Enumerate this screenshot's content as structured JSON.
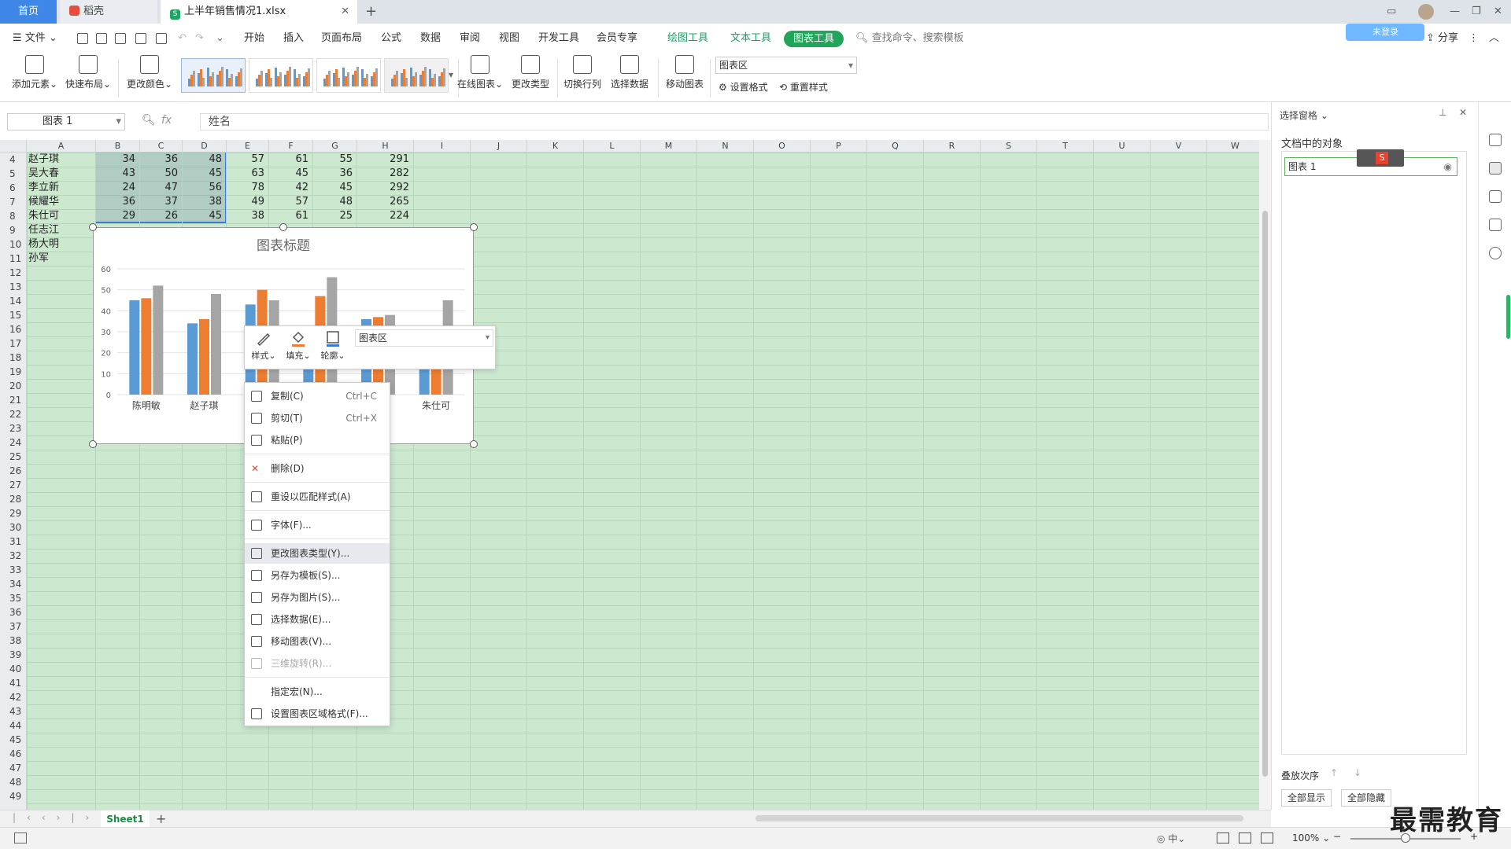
{
  "tabs": {
    "home": "首页",
    "daoke": "稻壳",
    "file": "上半年销售情况1.xlsx"
  },
  "menu": {
    "file": "文件",
    "items": [
      "开始",
      "插入",
      "页面布局",
      "公式",
      "数据",
      "审阅",
      "视图",
      "开发工具",
      "会员专享"
    ],
    "tools": [
      "绘图工具",
      "文本工具"
    ],
    "active_tool": "图表工具",
    "search": "查找命令、搜索模板",
    "share": "分享",
    "login_badge": "未登录"
  },
  "ribbon": {
    "add_element": "添加元素",
    "quick_layout": "快速布局",
    "change_color": "更改颜色",
    "online_chart": "在线图表",
    "change_type": "更改类型",
    "switch_row_col": "切换行列",
    "select_data": "选择数据",
    "move_chart": "移动图表",
    "area_select": "图表区",
    "set_format": "设置格式",
    "reset_style": "重置样式"
  },
  "formula": {
    "namebox": "图表 1",
    "fx": "fx",
    "value": "姓名"
  },
  "grid": {
    "columns": [
      "A",
      "B",
      "C",
      "D",
      "E",
      "F",
      "G",
      "H",
      "I",
      "J",
      "K",
      "L",
      "M",
      "N",
      "O",
      "P",
      "Q",
      "R",
      "S",
      "T",
      "U",
      "V",
      "W"
    ],
    "rows": [
      {
        "n": "4",
        "name": "赵子琪",
        "vals": [
          "34",
          "36",
          "48",
          "57",
          "61",
          "55",
          "291"
        ]
      },
      {
        "n": "5",
        "name": "吴大春",
        "vals": [
          "43",
          "50",
          "45",
          "63",
          "45",
          "36",
          "282"
        ]
      },
      {
        "n": "6",
        "name": "李立新",
        "vals": [
          "24",
          "47",
          "56",
          "78",
          "42",
          "45",
          "292"
        ]
      },
      {
        "n": "7",
        "name": "候耀华",
        "vals": [
          "36",
          "37",
          "38",
          "49",
          "57",
          "48",
          "265"
        ]
      },
      {
        "n": "8",
        "name": "朱仕可",
        "vals": [
          "29",
          "26",
          "45",
          "38",
          "61",
          "25",
          "224"
        ]
      },
      {
        "n": "9",
        "name": "任志江",
        "vals": []
      },
      {
        "n": "10",
        "name": "杨大明",
        "vals": []
      },
      {
        "n": "11",
        "name": "孙军",
        "vals": []
      }
    ],
    "row_numbers": [
      "12",
      "13",
      "14",
      "15",
      "16",
      "17",
      "18",
      "19",
      "20",
      "21",
      "22",
      "23",
      "24",
      "25",
      "26",
      "27",
      "28",
      "29",
      "30",
      "31",
      "32",
      "33",
      "34",
      "35",
      "36",
      "37",
      "38",
      "39",
      "40",
      "41",
      "42",
      "43",
      "44",
      "45",
      "46",
      "47",
      "48",
      "49"
    ]
  },
  "chart_data": {
    "type": "bar",
    "title": "图表标题",
    "categories": [
      "陈明敏",
      "赵子琪",
      "吴大春",
      "李立新",
      "候耀华",
      "朱仕可"
    ],
    "visible_category_labels": [
      "陈明敏",
      "赵子琪",
      "",
      "",
      "",
      "朱仕可"
    ],
    "series": [
      {
        "values": [
          45,
          34,
          43,
          24,
          36,
          29
        ],
        "color": "#5b9bd5"
      },
      {
        "values": [
          46,
          36,
          50,
          47,
          37,
          26
        ],
        "color": "#ed7d31"
      },
      {
        "values": [
          52,
          48,
          45,
          56,
          38,
          45
        ],
        "color": "#a5a5a5"
      }
    ],
    "ylim": [
      0,
      60
    ],
    "yticks": [
      "0",
      "10",
      "20",
      "30",
      "40",
      "50",
      "60"
    ],
    "grid": true
  },
  "minitb": {
    "style": "样式",
    "fill": "填充",
    "outline": "轮廓",
    "select": "图表区"
  },
  "context_menu": [
    {
      "label": "复制(C)",
      "shortcut": "Ctrl+C",
      "icon": "copy-icon"
    },
    {
      "label": "剪切(T)",
      "shortcut": "Ctrl+X",
      "icon": "cut-icon"
    },
    {
      "label": "粘贴(P)",
      "shortcut": "",
      "icon": "paste-icon"
    },
    {
      "label": "删除(D)",
      "shortcut": "",
      "icon": "delete-icon"
    },
    {
      "label": "重设以匹配样式(A)",
      "shortcut": "",
      "icon": "reset-style-icon"
    },
    {
      "label": "字体(F)...",
      "shortcut": "",
      "icon": "font-icon"
    },
    {
      "label": "更改图表类型(Y)...",
      "shortcut": "",
      "icon": "chart-type-icon"
    },
    {
      "label": "另存为模板(S)...",
      "shortcut": "",
      "icon": "save-template-icon"
    },
    {
      "label": "另存为图片(S)...",
      "shortcut": "",
      "icon": "save-image-icon"
    },
    {
      "label": "选择数据(E)...",
      "shortcut": "",
      "icon": "select-data-icon"
    },
    {
      "label": "移动图表(V)...",
      "shortcut": "",
      "icon": "move-chart-icon"
    },
    {
      "label": "三维旋转(R)...",
      "shortcut": "",
      "icon": "rotate-3d-icon"
    },
    {
      "label": "指定宏(N)...",
      "shortcut": "",
      "icon": ""
    },
    {
      "label": "设置图表区域格式(F)...",
      "shortcut": "",
      "icon": "format-area-icon"
    }
  ],
  "pane": {
    "header": "选择窗格",
    "title": "文档中的对象",
    "item": "图表 1",
    "order": "叠放次序",
    "show_all": "全部显示",
    "hide_all": "全部隐藏"
  },
  "sheet": {
    "tab": "Sheet1"
  },
  "status": {
    "zoom": "100%"
  },
  "watermark": "最需教育"
}
